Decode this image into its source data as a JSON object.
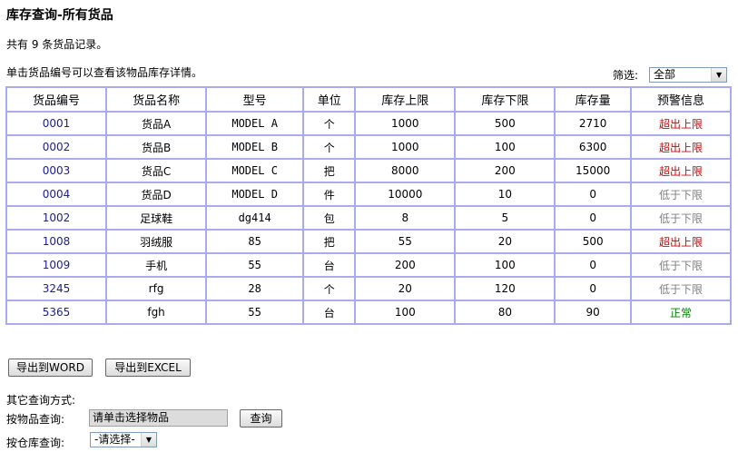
{
  "page_title": "库存查询-所有货品",
  "summary": "共有 9 条货品记录。",
  "hint": "单击货品编号可以查看该物品库存详情。",
  "filter": {
    "label": "筛选:",
    "selected": "全部"
  },
  "table": {
    "headers": [
      "货品编号",
      "货品名称",
      "型号",
      "单位",
      "库存上限",
      "库存下限",
      "库存量",
      "预警信息"
    ],
    "rows": [
      [
        "0001",
        "货品A",
        "MODEL A",
        "个",
        "1000",
        "500",
        "2710",
        "超出上限"
      ],
      [
        "0002",
        "货品B",
        "MODEL B",
        "个",
        "1000",
        "100",
        "6300",
        "超出上限"
      ],
      [
        "0003",
        "货品C",
        "MODEL C",
        "把",
        "8000",
        "200",
        "15000",
        "超出上限"
      ],
      [
        "0004",
        "货品D",
        "MODEL D",
        "件",
        "10000",
        "10",
        "0",
        "低于下限"
      ],
      [
        "1002",
        "足球鞋",
        "dg414",
        "包",
        "8",
        "5",
        "0",
        "低于下限"
      ],
      [
        "1008",
        "羽绒服",
        "85",
        "把",
        "55",
        "20",
        "500",
        "超出上限"
      ],
      [
        "1009",
        "手机",
        "55",
        "台",
        "200",
        "100",
        "0",
        "低于下限"
      ],
      [
        "3245",
        "rfg",
        "28",
        "个",
        "20",
        "120",
        "0",
        "低于下限"
      ],
      [
        "5365",
        "fgh",
        "55",
        "台",
        "100",
        "80",
        "90",
        "正常"
      ]
    ]
  },
  "status_colors": {
    "超出上限": "#dd0000",
    "低于下限": "#808080",
    "正常": "#008000"
  },
  "buttons": {
    "export_word": "导出到WORD",
    "export_excel": "导出到EXCEL"
  },
  "other_query": {
    "label": "其它查询方式:",
    "by_item_label": "按物品查询:",
    "by_item_value": "请单击选择物品",
    "query_button": "查询",
    "by_warehouse_label": "按仓库查询:",
    "by_warehouse_selected": "-请选择-"
  }
}
